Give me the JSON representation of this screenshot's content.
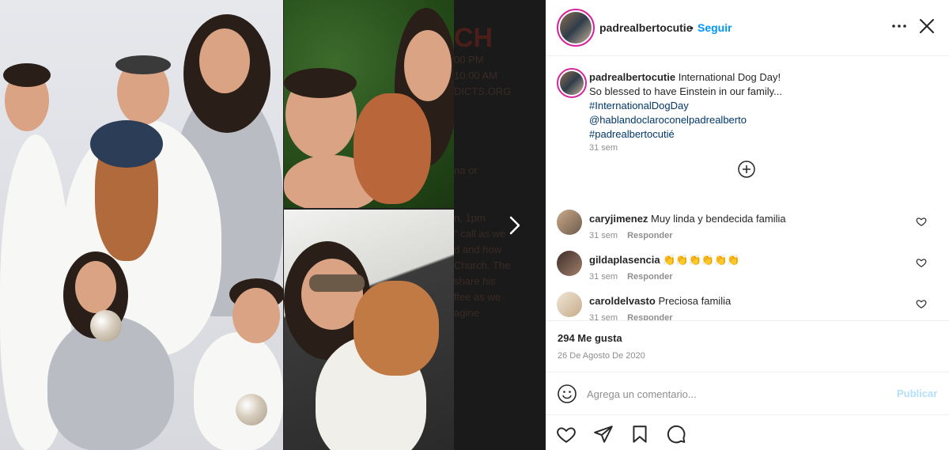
{
  "background": {
    "lines": [
      "CH",
      "00 PM",
      "10:00 AM",
      "DICTS.ORG",
      "na or",
      "n, 1pm",
      "\" call as we",
      "d and how",
      "Church. The",
      "share his",
      "ffee as we",
      "agine"
    ]
  },
  "header": {
    "username": "padrealbertocutie",
    "dot": "•",
    "follow_label": "Seguir"
  },
  "caption": {
    "username": "padrealbertocutie",
    "line1": " International Dog Day!",
    "line2": "So blessed to have Einstein in our family...",
    "tags": [
      "#InternationalDogDay",
      "@hablandoclaroconelpadrealberto",
      "#padrealbertocutié"
    ],
    "time": "31 sem"
  },
  "comments": [
    {
      "username": "caryjimenez",
      "text": " Muy linda y bendecida familia",
      "time": "31 sem",
      "reply": "Responder"
    },
    {
      "username": "gildaplasencia",
      "text": " 👏👏👏👏👏👏",
      "time": "31 sem",
      "reply": "Responder"
    },
    {
      "username": "caroldelvasto",
      "text": " Preciosa familia",
      "time": "31 sem",
      "reply": "Responder"
    }
  ],
  "stats": {
    "likes": "294 Me gusta",
    "date": "26 De Agosto De 2020"
  },
  "composer": {
    "placeholder": "Agrega un comentario...",
    "publish_label": "Publicar"
  },
  "colors": {
    "accent_blue": "#0095f6",
    "publish_disabled": "#b2dffc",
    "tag_blue": "#00376b",
    "muted": "#8e8e8e"
  },
  "icons": [
    "more-icon",
    "close-icon",
    "add-circle-icon",
    "heart-icon",
    "comment-icon",
    "share-icon",
    "bookmark-icon",
    "emoji-icon",
    "chevron-right-icon"
  ]
}
